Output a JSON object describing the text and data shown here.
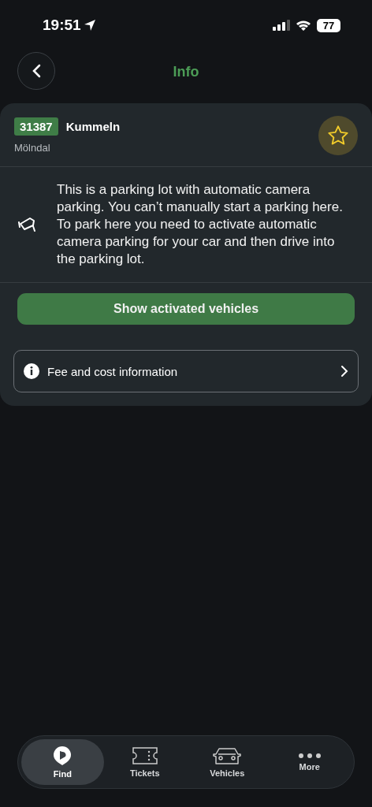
{
  "status_bar": {
    "time": "19:51",
    "battery": "77"
  },
  "header": {
    "title": "Info"
  },
  "location": {
    "code": "31387",
    "name": "Kummeln",
    "city": "Mölndal"
  },
  "description": "This is a parking lot with automatic camera parking. You can’t manually start a parking here. To park here you need to activate automatic camera parking for your car and then drive into the parking lot.",
  "primary_button": "Show activated vehicles",
  "info_row": "Fee and cost information",
  "tab_bar": [
    {
      "kind": "find",
      "label": "Find",
      "selected": true
    },
    {
      "kind": "tickets",
      "label": "Tickets",
      "selected": false
    },
    {
      "kind": "vehicles",
      "label": "Vehicles",
      "selected": false
    },
    {
      "kind": "more",
      "label": "More",
      "selected": false
    }
  ]
}
